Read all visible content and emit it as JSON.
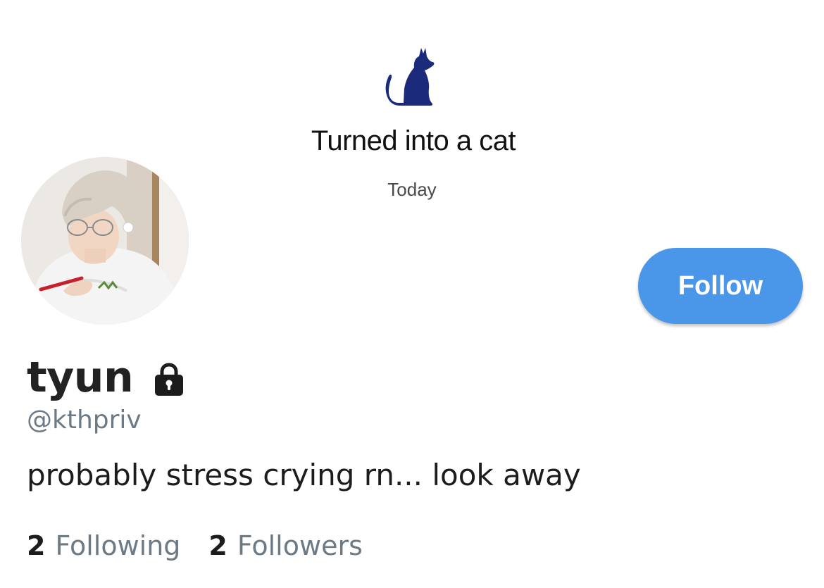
{
  "banner": {
    "icon": "cat-icon",
    "title": "Turned into a cat",
    "date": "Today"
  },
  "profile": {
    "avatar": "profile-photo",
    "display_name": "tyun",
    "locked_icon": "lock-icon",
    "handle": "@kthpriv",
    "bio": "probably stress crying rn... look away"
  },
  "actions": {
    "follow_label": "Follow"
  },
  "stats": {
    "following_count": "2",
    "following_label": "Following",
    "followers_count": "2",
    "followers_label": "Followers"
  },
  "colors": {
    "accent": "#4a97ea",
    "cat_icon": "#1b2a7a",
    "muted_text": "#6c7a86",
    "primary_text": "#1c1c1c"
  }
}
